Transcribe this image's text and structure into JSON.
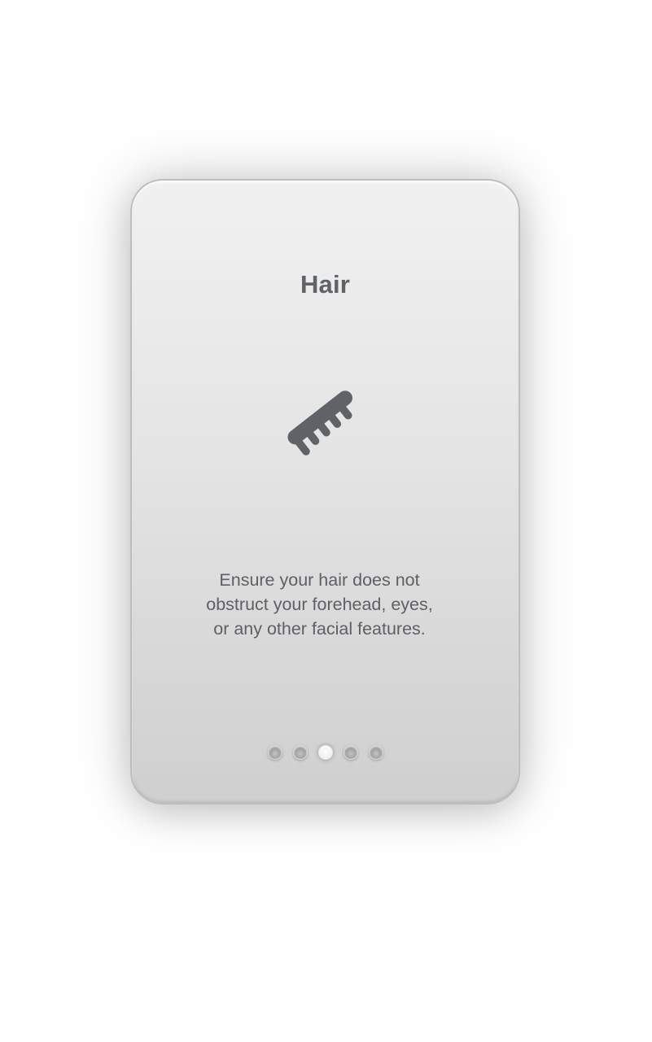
{
  "card": {
    "title": "Hair",
    "icon": "comb-icon",
    "message_lines": [
      "Ensure your hair does not",
      "obstruct your forehead, eyes,",
      "or any other facial features."
    ]
  },
  "pagination": {
    "total": 5,
    "active_index": 2
  },
  "colors": {
    "text": "#5f6266",
    "icon": "#5f6266",
    "card_top": "#f1f1f1",
    "card_bottom": "#cfcfcf"
  }
}
